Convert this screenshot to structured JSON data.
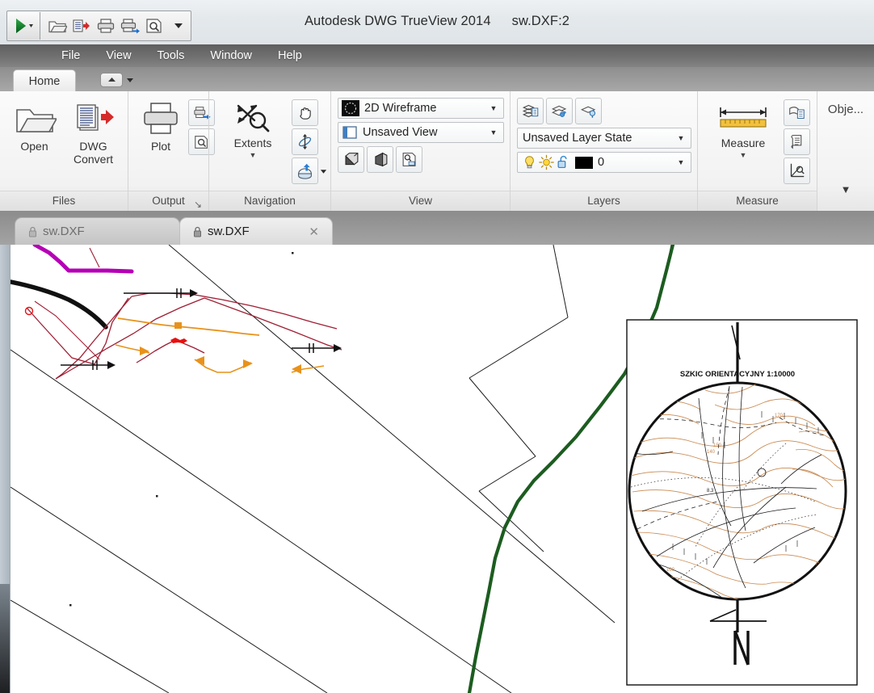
{
  "window": {
    "title": "Autodesk DWG TrueView 2014",
    "filename": "sw.DXF:2"
  },
  "quick_access": {
    "app_button": "app-menu",
    "items": [
      {
        "name": "open-icon",
        "tooltip": "Open"
      },
      {
        "name": "dwg-convert-icon",
        "tooltip": "DWG Convert"
      },
      {
        "name": "plot-icon",
        "tooltip": "Plot"
      },
      {
        "name": "publish-icon",
        "tooltip": "Publish"
      },
      {
        "name": "preview-icon",
        "tooltip": "Plot Preview"
      },
      {
        "name": "overflow-chevron-icon",
        "tooltip": "Customize"
      }
    ]
  },
  "menu": {
    "items": [
      "File",
      "View",
      "Tools",
      "Window",
      "Help"
    ]
  },
  "ribbon": {
    "tabs": [
      {
        "label": "Home",
        "active": true
      }
    ],
    "minimize_label": "",
    "panels": [
      {
        "label": "Files",
        "dialog_launcher": false,
        "buttons": [
          {
            "label": "Open",
            "icon": "open-folder-icon"
          },
          {
            "label": "DWG\nConvert",
            "label_line1": "DWG",
            "label_line2": "Convert",
            "icon": "dwg-convert-icon"
          }
        ]
      },
      {
        "label": "Output",
        "dialog_launcher": true,
        "dialog_launcher_glyph": "↘",
        "buttons": [
          {
            "label": "Plot",
            "icon": "plotter-icon"
          }
        ],
        "small_buttons": [
          {
            "icon": "publish-icon"
          },
          {
            "icon": "plot-preview-icon"
          }
        ]
      },
      {
        "label": "Navigation",
        "dialog_launcher": false,
        "buttons": [
          {
            "label": "Extents",
            "icon": "zoom-extents-icon",
            "has_dropdown": true
          }
        ],
        "small_buttons": [
          {
            "icon": "pan-hand-icon"
          },
          {
            "icon": "orbit-icon"
          },
          {
            "icon": "steering-wheel-icon",
            "has_dropdown": true
          }
        ]
      },
      {
        "label": "View",
        "dialog_launcher": false,
        "combos": [
          {
            "name": "visual-style-combo",
            "value": "2D Wireframe",
            "icon": "visual-style-icon"
          },
          {
            "name": "view-combo",
            "value": "Unsaved View",
            "icon": "view-icon"
          }
        ],
        "small_buttons": [
          {
            "icon": "parallel-projection-icon"
          },
          {
            "icon": "perspective-projection-icon"
          },
          {
            "icon": "view-manager-icon"
          }
        ]
      },
      {
        "label": "Layers",
        "dialog_launcher": false,
        "small_buttons": [
          {
            "icon": "layer-properties-icon"
          },
          {
            "icon": "layer-state-icon"
          },
          {
            "icon": "layer-isolate-icon"
          }
        ],
        "combos": [
          {
            "name": "layer-state-combo",
            "value": "Unsaved Layer State"
          },
          {
            "name": "layer-combo",
            "value": "0",
            "color": "#000000",
            "status_icons": [
              "lightbulb-icon",
              "sun-icon",
              "unlock-icon"
            ]
          }
        ]
      },
      {
        "label": "Measure",
        "dialog_launcher": false,
        "buttons": [
          {
            "label": "Measure",
            "icon": "ruler-icon",
            "has_dropdown": true
          }
        ],
        "small_buttons": [
          {
            "icon": "object-properties-icon"
          },
          {
            "icon": "list-icon"
          },
          {
            "icon": "locate-point-icon"
          }
        ]
      },
      {
        "label": "",
        "truncated_label": "Obje...",
        "dialog_launcher": false,
        "collapsed": true,
        "collapse_glyph": "▼"
      }
    ]
  },
  "document_tabs": [
    {
      "label": "sw.DXF",
      "active": false,
      "locked": true,
      "lock_icon": "lock-icon"
    },
    {
      "label": "sw.DXF",
      "active": true,
      "locked": true,
      "lock_icon": "lock-icon",
      "close_icon": "close-icon",
      "close_glyph": "✕"
    }
  ],
  "drawing": {
    "inset_map": {
      "title": "SZKIC ORIENTACYJNY 1:10000",
      "north_label": "N"
    },
    "colors": {
      "parcel_line": "#1c1c1c",
      "road_green": "#1c5c20",
      "boundary_crimson": "#9e1f34",
      "annotation_orange": "#e8921a",
      "highlight_magenta": "#b500b5",
      "marker_red": "#e81010",
      "contour_orange": "#c98a52",
      "background": "#ffffff"
    }
  }
}
